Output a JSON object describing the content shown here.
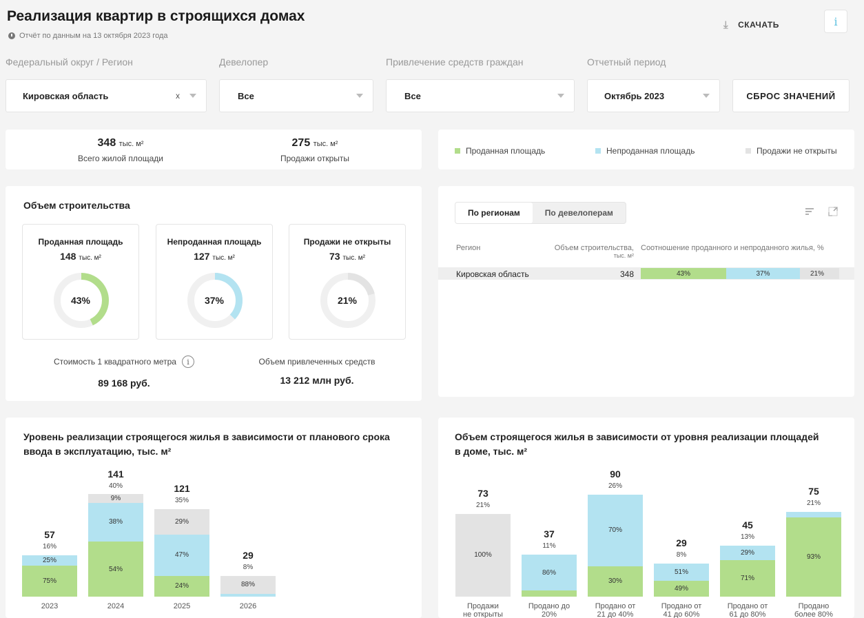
{
  "header": {
    "title": "Реализация квартир в строящихся домах",
    "subtitle": "Отчёт по данным на 13 октября 2023 года",
    "download_label": "СКАЧАТЬ",
    "info_label": "i"
  },
  "filters": {
    "region": {
      "label": "Федеральный округ / Регион",
      "value": "Кировская область",
      "clear": "x"
    },
    "developer": {
      "label": "Девелопер",
      "value": "Все"
    },
    "funding": {
      "label": "Привлечение средств граждан",
      "value": "Все"
    },
    "period": {
      "label": "Отчетный период",
      "value": "Октябрь 2023"
    },
    "reset_label": "СБРОС ЗНАЧЕНИЙ"
  },
  "kpi": {
    "total": {
      "value": "348",
      "unit": "тыс. м²",
      "label": "Всего жилой площади"
    },
    "open": {
      "value": "275",
      "unit": "тыс. м²",
      "label": "Продажи открыты"
    }
  },
  "legend": {
    "sold": "Проданная площадь",
    "unsold": "Непроданная площадь",
    "closed": "Продажи не открыты"
  },
  "colors": {
    "sold": "#b2dd8b",
    "unsold": "#b3e3f1",
    "closed": "#e3e3e3"
  },
  "volume": {
    "title": "Объем строительства",
    "cards": [
      {
        "title": "Проданная площадь",
        "value": "148",
        "unit": "тыс. м²",
        "pct_label": "43%",
        "fraction": 0.43,
        "color": "#b2dd8b"
      },
      {
        "title": "Непроданная площадь",
        "value": "127",
        "unit": "тыс. м²",
        "pct_label": "37%",
        "fraction": 0.37,
        "color": "#b3e3f1"
      },
      {
        "title": "Продажи не открыты",
        "value": "73",
        "unit": "тыс. м²",
        "pct_label": "21%",
        "fraction": 0.21,
        "color": "#e3e3e3"
      }
    ],
    "price_label": "Стоимость 1 квадратного метра",
    "price_value": "89 168 руб.",
    "funds_label": "Объем привлеченных средств",
    "funds_value": "13 212 млн руб."
  },
  "table": {
    "tab_regions": "По регионам",
    "tab_developers": "По девелоперам",
    "col_region": "Регион",
    "col_volume_1": "Объем строительства,",
    "col_volume_2": "тыс. м²",
    "col_ratio": "Соотношение проданного и непроданного жилья, %",
    "rows": [
      {
        "region": "Кировская область",
        "volume": "348",
        "sold": "43%",
        "unsold": "37%",
        "closed": "21%",
        "sold_frac": 0.43,
        "unsold_frac": 0.37,
        "closed_frac": 0.2
      }
    ]
  },
  "chart_data": [
    {
      "type": "bar",
      "title_1": "Уровень реализации строящегося жилья в зависимости от планового срока",
      "title_2": "ввода в эксплуатацию, тыс. м²",
      "categories": [
        "2023",
        "2024",
        "2025",
        "2026"
      ],
      "totals": [
        "57",
        "141",
        "121",
        "29"
      ],
      "total_pct": [
        "16%",
        "40%",
        "35%",
        "8%"
      ],
      "series": [
        {
          "values": [
            75,
            54,
            24,
            0
          ],
          "labels": [
            "75%",
            "54%",
            "24%",
            ""
          ]
        },
        {
          "values": [
            25,
            38,
            47,
            12
          ],
          "labels": [
            "25%",
            "38%",
            "47%",
            ""
          ]
        },
        {
          "values": [
            0,
            9,
            29,
            88
          ],
          "labels": [
            "",
            "9%",
            "29%",
            "88%"
          ]
        }
      ],
      "totals_num": [
        57,
        141,
        121,
        29
      ]
    },
    {
      "type": "bar",
      "title_1": "Объем строящегося жилья в зависимости от уровня реализации площадей",
      "title_2": "в доме, тыс. м²",
      "categories": [
        [
          "Продажи",
          "не открыты"
        ],
        [
          "Продано до",
          "20%"
        ],
        [
          "Продано от",
          "21 до 40%"
        ],
        [
          "Продано от",
          "41 до 60%"
        ],
        [
          "Продано от",
          "61 до 80%"
        ],
        [
          "Продано",
          "более 80%"
        ]
      ],
      "totals": [
        "73",
        "37",
        "90",
        "29",
        "45",
        "75"
      ],
      "total_pct": [
        "21%",
        "11%",
        "26%",
        "8%",
        "13%",
        "21%"
      ],
      "series": [
        {
          "values": [
            0,
            14,
            30,
            49,
            71,
            93
          ],
          "labels": [
            "",
            "",
            "30%",
            "49%",
            "71%",
            "93%"
          ]
        },
        {
          "values": [
            0,
            86,
            70,
            51,
            29,
            7
          ],
          "labels": [
            "",
            "86%",
            "70%",
            "51%",
            "29%",
            ""
          ]
        },
        {
          "values": [
            100,
            0,
            0,
            0,
            0,
            0
          ],
          "labels": [
            "100%",
            "",
            "",
            "",
            "",
            ""
          ]
        }
      ],
      "totals_num": [
        73,
        37,
        90,
        29,
        45,
        75
      ]
    }
  ]
}
